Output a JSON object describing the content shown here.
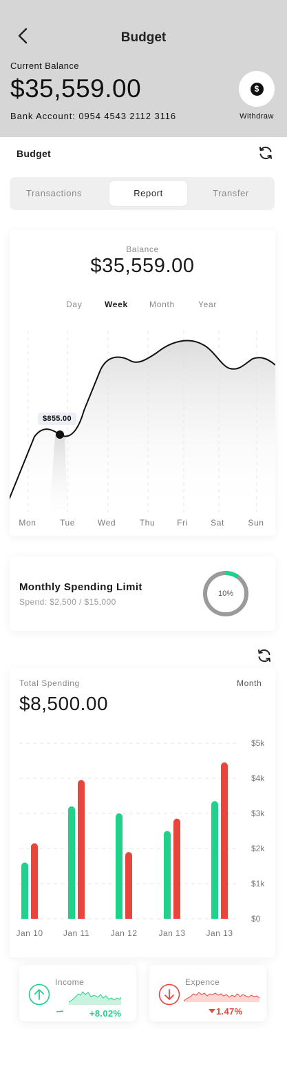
{
  "header": {
    "title": "Budget",
    "current_balance_label": "Current Balance",
    "current_balance": "$35,559.00",
    "bank_account": "Bank Account: 0954 4543 2112 3116",
    "withdraw_label": "Withdraw"
  },
  "section": {
    "title": "Budget"
  },
  "tabs": [
    {
      "label": "Transactions",
      "active": false
    },
    {
      "label": "Report",
      "active": true
    },
    {
      "label": "Transfer",
      "active": false
    }
  ],
  "balance_card": {
    "label": "Balance",
    "amount": "$35,559.00",
    "periods": [
      "Day",
      "Week",
      "Month",
      "Year"
    ],
    "active_period": "Week",
    "tooltip": "$855.00",
    "days": [
      "Mon",
      "Tue",
      "Wed",
      "Thu",
      "Fri",
      "Sat",
      "Sun"
    ]
  },
  "spending_limit": {
    "title": "Monthly Spending Limit",
    "subtitle": "Spend: $2,500 / $15,000",
    "percent_label": "10%",
    "percent": 0.1
  },
  "total_spending": {
    "label": "Total Spending",
    "period": "Month",
    "amount": "$8,500.00"
  },
  "chart_data": {
    "type": "bar",
    "categories": [
      "Jan 10",
      "Jan 11",
      "Jan 12",
      "Jan 13",
      "Jan 13"
    ],
    "series": [
      {
        "color": "#1fd18a",
        "values": [
          1600,
          3200,
          3000,
          2500,
          3350
        ]
      },
      {
        "color": "#e8453c",
        "values": [
          2150,
          3950,
          1900,
          2850,
          4450
        ]
      }
    ],
    "y_ticks": [
      "$0",
      "$1k",
      "$2k",
      "$3k",
      "$4k",
      "$5k"
    ],
    "ylim": [
      0,
      5000
    ],
    "grid": true
  },
  "income": {
    "label": "Income",
    "change": "+8.02%",
    "color": "#1fd18a"
  },
  "expense": {
    "label": "Expence",
    "change": "1.47%",
    "color": "#e8453c"
  }
}
